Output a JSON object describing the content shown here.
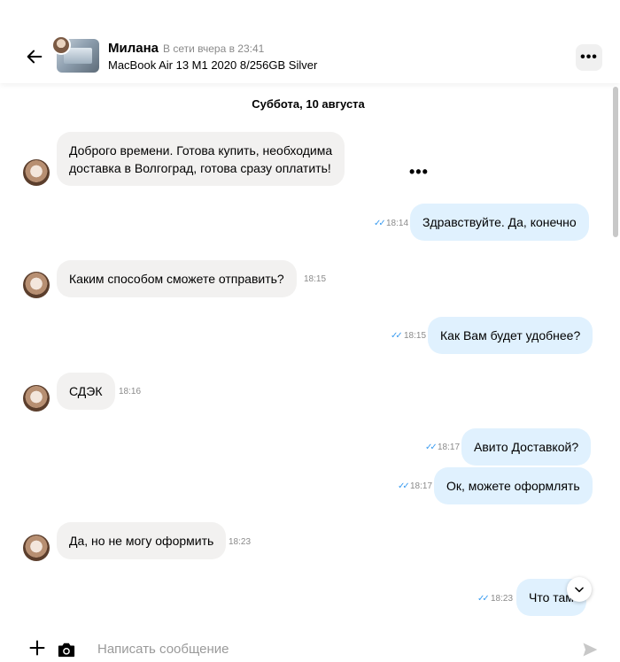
{
  "header": {
    "name": "Милана",
    "status": "В сети вчера в 23:41",
    "item_title": "MacBook Air 13 M1 2020 8/256GB Silver",
    "menu_label": "•••"
  },
  "chat": {
    "date": "Суббота, 10 августа",
    "more_label": "•••",
    "messages": [
      {
        "line1": "Доброго времени. Готова купить, необходима",
        "line2": "доставка в Волгоград, готова сразу оплатить!"
      },
      {
        "text": "Здравствуйте. Да, конечно",
        "time": "18:14"
      },
      {
        "text": "Каким способом сможете отправить?",
        "time": "18:15"
      },
      {
        "text": "Как Вам будет удобнее?",
        "time": "18:15"
      },
      {
        "text": "СДЭК",
        "time": "18:16"
      },
      {
        "text": "Авито Доставкой?",
        "time": "18:17"
      },
      {
        "text": "Ок, можете оформлять",
        "time": "18:17"
      },
      {
        "text": "Да, но не могу оформить",
        "time": "18:23"
      },
      {
        "text": "Что там",
        "time": "18:23"
      }
    ],
    "check_glyph": "✓✓"
  },
  "composer": {
    "placeholder": "Написать сообщение"
  },
  "colors": {
    "incoming_bubble": "#f2f1f0",
    "outgoing_bubble": "#e0f1fe",
    "read_check": "#3b9cf0"
  }
}
